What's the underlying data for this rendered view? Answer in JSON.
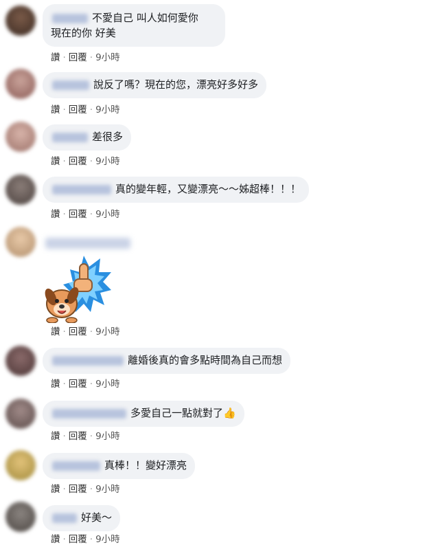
{
  "comments": [
    {
      "text_line1": "不愛自己 叫人如何愛你",
      "text_line2": "現在的你 好美",
      "like": "讚",
      "dot": "·",
      "reply": "回覆",
      "time": "9小時"
    },
    {
      "text": "說反了嗎？現在的您，漂亮好多好多",
      "like": "讚",
      "dot": "·",
      "reply": "回覆",
      "time": "9小時"
    },
    {
      "text": "差很多",
      "like": "讚",
      "dot": "·",
      "reply": "回覆",
      "time": "9小時"
    },
    {
      "text": "真的變年輕，又變漂亮～～姊超棒！！！",
      "like": "讚",
      "dot": "·",
      "reply": "回覆",
      "time": "9小時"
    },
    {
      "text": "",
      "like": "讚",
      "dot": "·",
      "reply": "回覆",
      "time": "9小時"
    },
    {
      "text": "離婚後真的會多點時間為自己而想",
      "like": "讚",
      "dot": "·",
      "reply": "回覆",
      "time": "9小時"
    },
    {
      "text": "多愛自己一點就對了",
      "like": "讚",
      "dot": "·",
      "reply": "回覆",
      "time": "9小時"
    },
    {
      "text": "真棒！！變好漂亮",
      "like": "讚",
      "dot": "·",
      "reply": "回覆",
      "time": "9小時"
    },
    {
      "text": "好美～",
      "like": "讚",
      "dot": "·",
      "reply": "回覆",
      "time": "9小時"
    }
  ],
  "icons": {
    "thumbs_up": "thumbs-up-emoji",
    "sticker": "dog-thumbs-up-sticker"
  },
  "colors": {
    "bubble": "#f0f2f5",
    "text": "#1c1e21",
    "meta": "#555555"
  }
}
